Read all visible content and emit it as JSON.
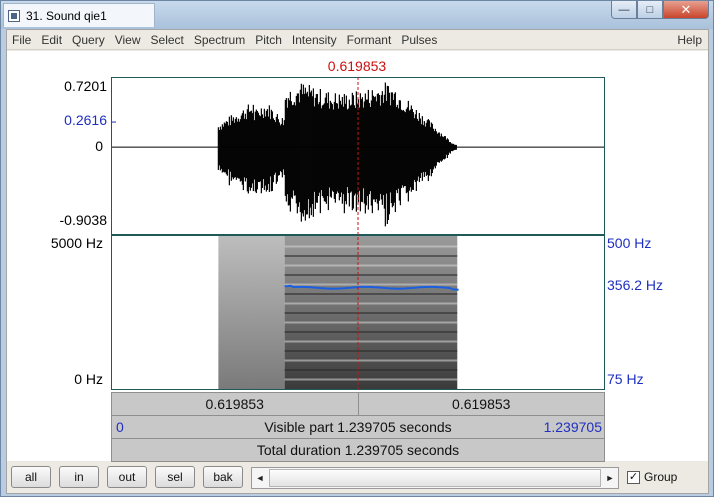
{
  "window": {
    "title": "31. Sound qie1"
  },
  "controls": {
    "minimize": "—",
    "maximize": "□",
    "close": "✕"
  },
  "menu": {
    "items": [
      "File",
      "Edit",
      "Query",
      "View",
      "Select",
      "Spectrum",
      "Pitch",
      "Intensity",
      "Formant",
      "Pulses"
    ],
    "help": "Help"
  },
  "cursor": {
    "time_label": "0.619853",
    "time": 0.619853
  },
  "waveform": {
    "ymax_label": "0.7201",
    "ycursor_label": "0.2616",
    "yzero_label": "0",
    "ymin_label": "-0.9038",
    "ylim": [
      -0.9038,
      0.7201
    ],
    "cursor_value": 0.2616,
    "voiced_start": 0.268,
    "voiced_end": 0.87
  },
  "spectrogram": {
    "fmax_label": "5000 Hz",
    "fmin_label": "0 Hz",
    "pitch_max_label": "500 Hz",
    "pitch_cursor_label": "356.2 Hz",
    "pitch_min_label": "75 Hz",
    "pitch_range": [
      75,
      500
    ],
    "pitch_value": 356.2,
    "pitch_start": 0.435,
    "pitch_end": 0.878
  },
  "timebar": {
    "left": "0.619853",
    "right": "0.619853",
    "visible_start": "0",
    "visible_text": "Visible part 1.239705 seconds",
    "visible_end": "1.239705",
    "total_text": "Total duration 1.239705 seconds",
    "duration": 1.239705
  },
  "toolbar": {
    "buttons": [
      "all",
      "in",
      "out",
      "sel",
      "bak"
    ],
    "group_label": "Group",
    "group_checked": "✓",
    "scroll_left": "◄",
    "scroll_right": "►"
  }
}
